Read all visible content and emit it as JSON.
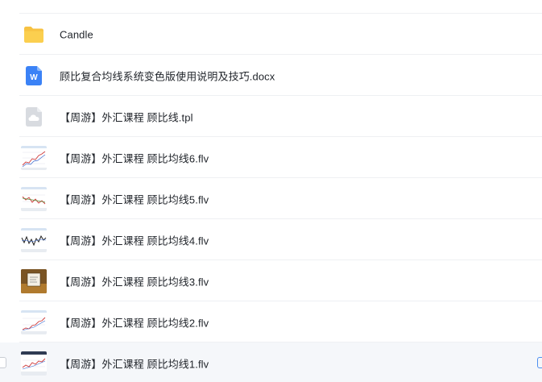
{
  "files": [
    {
      "name": "Candle",
      "icon": "folder-icon"
    },
    {
      "name": "顾比复合均线系统变色版使用说明及技巧.docx",
      "icon": "word-doc-icon"
    },
    {
      "name": "【周游】外汇课程 顾比线.tpl",
      "icon": "cloud-file-icon"
    },
    {
      "name": "【周游】外汇课程 顾比均线6.flv",
      "icon": "video-thumbnail"
    },
    {
      "name": "【周游】外汇课程 顾比均线5.flv",
      "icon": "video-thumbnail"
    },
    {
      "name": "【周游】外汇课程 顾比均线4.flv",
      "icon": "video-thumbnail"
    },
    {
      "name": "【周游】外汇课程 顾比均线3.flv",
      "icon": "video-thumbnail"
    },
    {
      "name": "【周游】外汇课程 顾比均线2.flv",
      "icon": "video-thumbnail"
    },
    {
      "name": "【周游】外汇课程 顾比均线1.flv",
      "icon": "video-thumbnail"
    }
  ],
  "colors": {
    "folder": "#f7c242",
    "word": "#3b82f6",
    "cloud_file": "#d5d8dd",
    "hover_row": "#f5f7fa",
    "text": "#1f2329",
    "divider": "#eef0f3"
  }
}
